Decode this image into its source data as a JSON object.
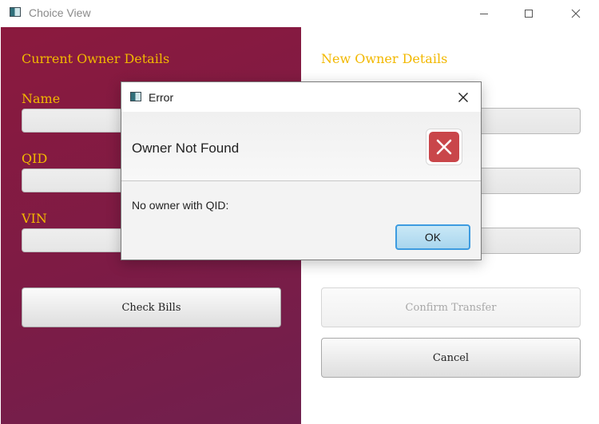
{
  "window": {
    "title": "Choice View",
    "icon": "app-window-icon",
    "controls": [
      "minimize-icon",
      "maximize-icon",
      "close-icon"
    ]
  },
  "left_panel": {
    "title": "Current Owner Details",
    "fields": [
      {
        "label": "Name",
        "value": ""
      },
      {
        "label": "QID",
        "value": ""
      },
      {
        "label": "VIN",
        "value": ""
      }
    ],
    "check_bills_label": "Check Bills"
  },
  "right_panel": {
    "title": "New Owner Details",
    "confirm_label": "Confirm Transfer",
    "cancel_label": "Cancel"
  },
  "dialog": {
    "title": "Error",
    "header": "Owner Not Found",
    "content": "No owner with QID:",
    "ok_label": "OK",
    "icon": "error-x-icon"
  },
  "colors": {
    "accent": "#f2b800",
    "panel_bg": "#7d1b45",
    "error_red": "#c9464a",
    "default_button_border": "#3d9be0"
  }
}
